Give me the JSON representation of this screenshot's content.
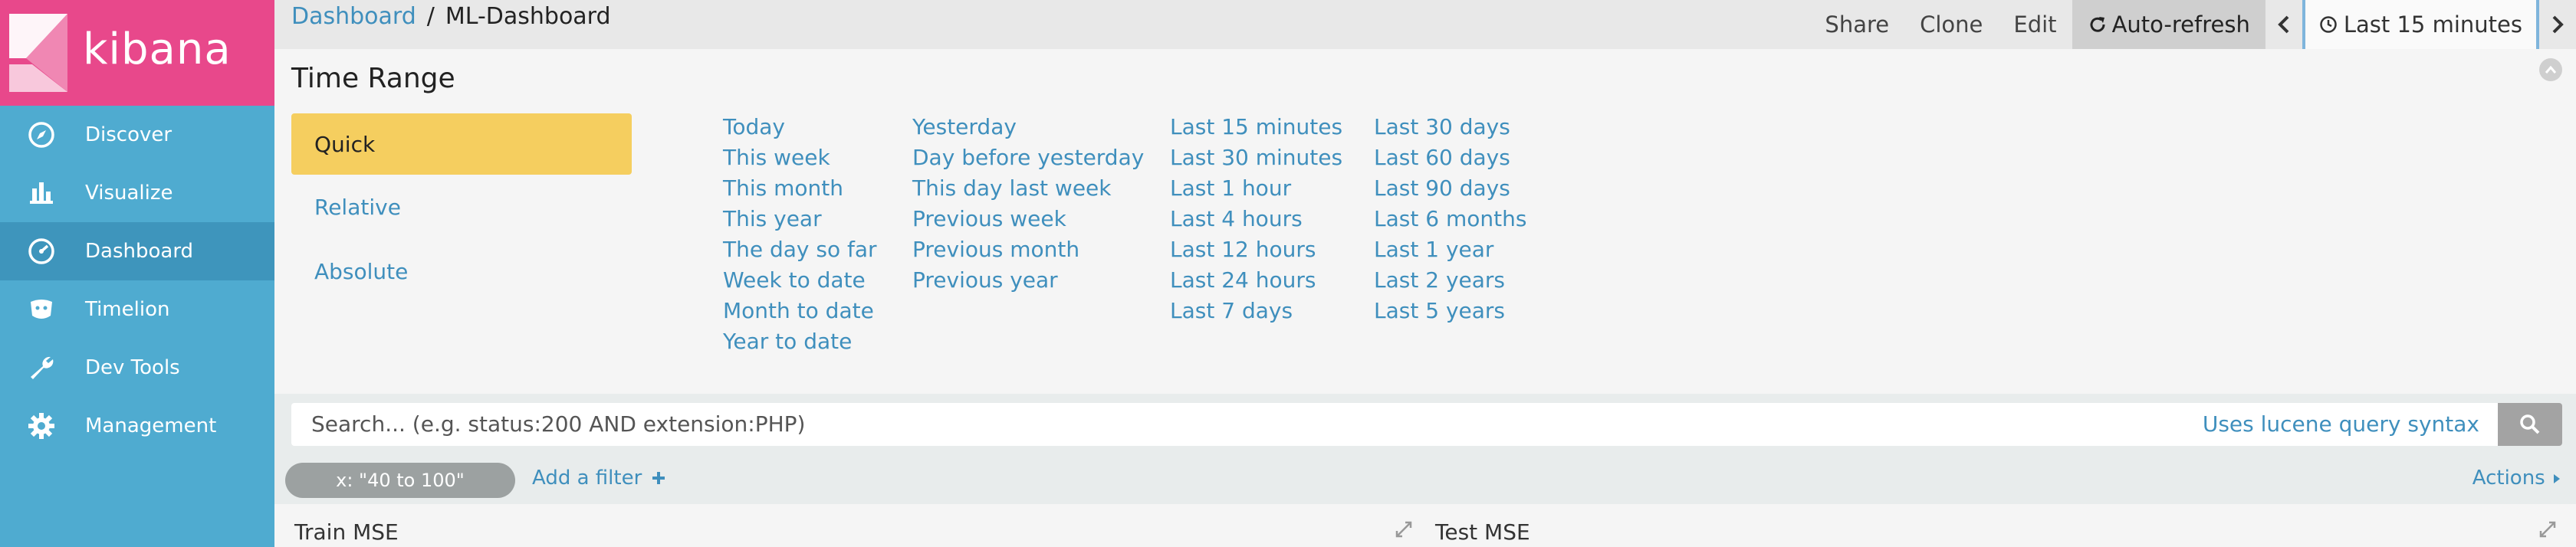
{
  "brand": {
    "name": "kibana"
  },
  "sidebar": {
    "items": [
      {
        "label": "Discover",
        "icon": "compass-icon"
      },
      {
        "label": "Visualize",
        "icon": "bar-chart-icon"
      },
      {
        "label": "Dashboard",
        "icon": "dashboard-icon",
        "active": true
      },
      {
        "label": "Timelion",
        "icon": "timelion-icon"
      },
      {
        "label": "Dev Tools",
        "icon": "wrench-icon"
      },
      {
        "label": "Management",
        "icon": "gear-icon"
      }
    ]
  },
  "breadcrumb": {
    "parent": "Dashboard",
    "separator": "/",
    "current": "ML-Dashboard"
  },
  "toolbar": {
    "share": "Share",
    "clone": "Clone",
    "edit": "Edit",
    "auto_refresh": "Auto-refresh",
    "time_label": "Last 15 minutes"
  },
  "time_range": {
    "title": "Time Range",
    "modes": [
      "Quick",
      "Relative",
      "Absolute"
    ],
    "active_mode": "Quick",
    "columns": [
      [
        "Today",
        "This week",
        "This month",
        "This year",
        "The day so far",
        "Week to date",
        "Month to date",
        "Year to date"
      ],
      [
        "Yesterday",
        "Day before yesterday",
        "This day last week",
        "Previous week",
        "Previous month",
        "Previous year"
      ],
      [
        "Last 15 minutes",
        "Last 30 minutes",
        "Last 1 hour",
        "Last 4 hours",
        "Last 12 hours",
        "Last 24 hours",
        "Last 7 days"
      ],
      [
        "Last 30 days",
        "Last 60 days",
        "Last 90 days",
        "Last 6 months",
        "Last 1 year",
        "Last 2 years",
        "Last 5 years"
      ]
    ]
  },
  "search": {
    "placeholder": "Search... (e.g. status:200 AND extension:PHP)",
    "syntax_link": "Uses lucene query syntax"
  },
  "filters": {
    "pills": [
      "x: \"40 to 100\""
    ],
    "add_label": "Add a filter",
    "actions_label": "Actions"
  },
  "panels": [
    {
      "title": "Train MSE"
    },
    {
      "title": "Test MSE"
    }
  ],
  "colors": {
    "sidebar": "#4FABD0",
    "logo_bg": "#E8488B",
    "active_mode": "#F5CE5F",
    "link": "#3f8fbd"
  }
}
